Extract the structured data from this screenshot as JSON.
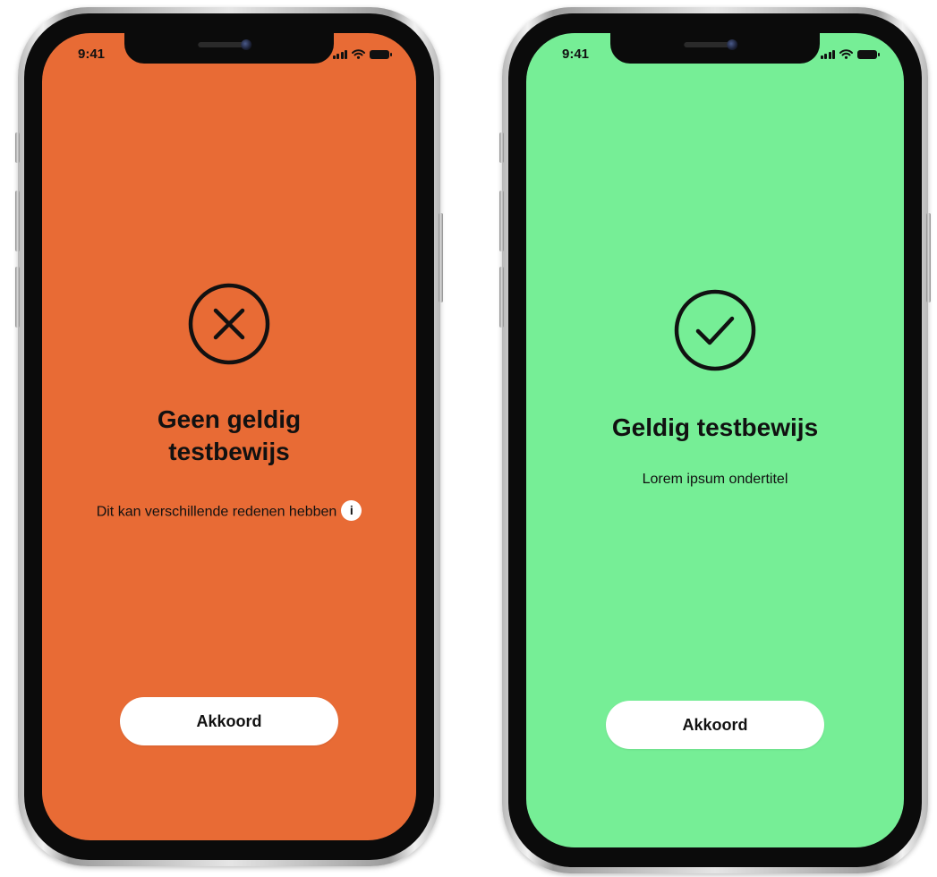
{
  "colors": {
    "invalid_bg": "#E86B35",
    "valid_bg": "#76EE96",
    "button_bg": "#FFFFFF",
    "text": "#111111"
  },
  "phone_left": {
    "status_time": "9:41",
    "icon": "circle-x-icon",
    "title": "Geen geldig testbewijs",
    "subtitle": "Dit kan verschillende redenen hebben",
    "info_icon_label": "i",
    "button_label": "Akkoord"
  },
  "phone_right": {
    "status_time": "9:41",
    "icon": "circle-check-icon",
    "title": "Geldig testbewijs",
    "subtitle": "Lorem ipsum ondertitel",
    "button_label": "Akkoord"
  }
}
